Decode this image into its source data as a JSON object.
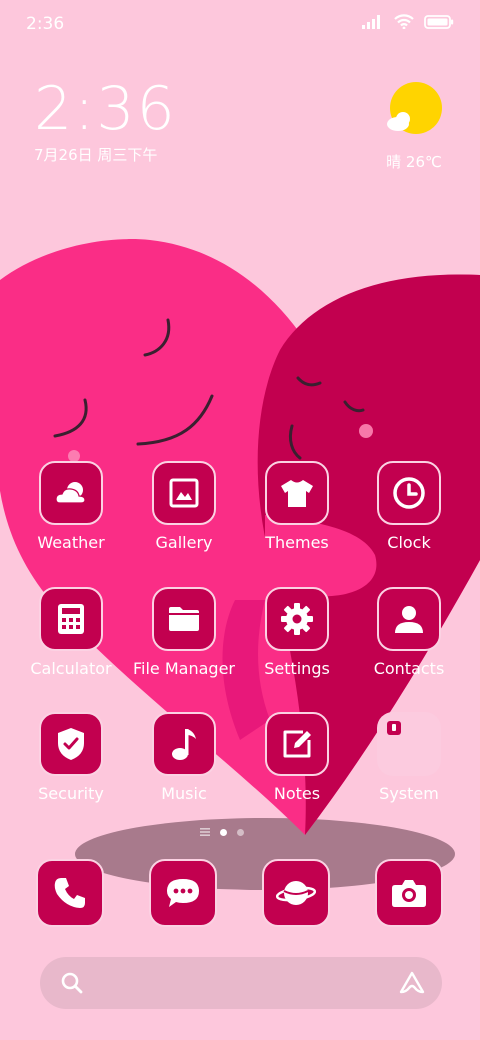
{
  "status_bar": {
    "time": "2:36"
  },
  "clock_widget": {
    "time": "2:36",
    "date": "7月26日 周三下午"
  },
  "weather_widget": {
    "condition": "晴",
    "temperature": "26℃"
  },
  "apps": [
    {
      "label": "Weather",
      "icon": "weather-icon"
    },
    {
      "label": "Gallery",
      "icon": "gallery-icon"
    },
    {
      "label": "Themes",
      "icon": "themes-icon"
    },
    {
      "label": "Clock",
      "icon": "clock-icon"
    },
    {
      "label": "Calculator",
      "icon": "calculator-icon"
    },
    {
      "label": "File Manager",
      "icon": "folder-icon"
    },
    {
      "label": "Settings",
      "icon": "gear-icon"
    },
    {
      "label": "Contacts",
      "icon": "contacts-icon"
    },
    {
      "label": "Security",
      "icon": "shield-icon"
    },
    {
      "label": "Music",
      "icon": "music-note-icon"
    },
    {
      "label": "Notes",
      "icon": "notes-icon"
    },
    {
      "label": "System",
      "icon": "system-folder-icon"
    }
  ],
  "dock": [
    {
      "icon": "phone-icon"
    },
    {
      "icon": "messages-icon"
    },
    {
      "icon": "browser-icon"
    },
    {
      "icon": "camera-icon"
    }
  ],
  "colors": {
    "background": "#fdc7dc",
    "icon_fill": "#c2004f",
    "heart_left": "#fa2d86",
    "heart_right": "#c2004f",
    "sun": "#ffd400"
  }
}
